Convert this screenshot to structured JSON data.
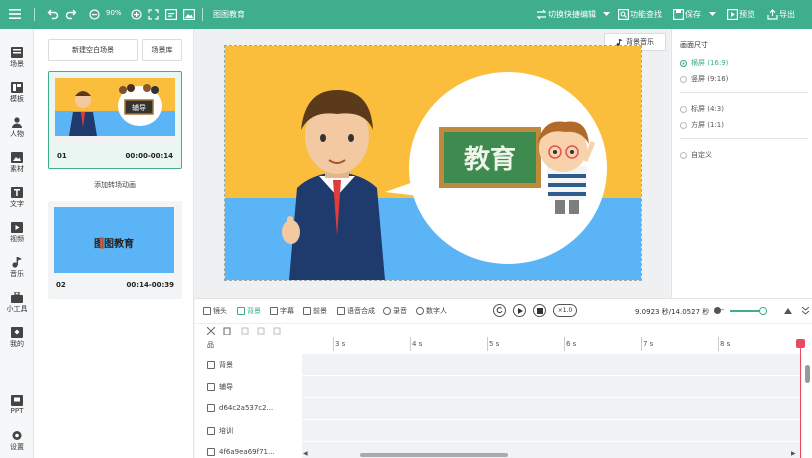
{
  "toolbar": {
    "zoom": "90%",
    "title": "图图教育",
    "quick_edit": "切换快捷编辑",
    "feature_search": "功能查找",
    "save": "保存",
    "preview": "预览",
    "export": "导出"
  },
  "rail": [
    {
      "label": "场景",
      "icon": "scene-icon"
    },
    {
      "label": "模板",
      "icon": "template-icon"
    },
    {
      "label": "人物",
      "icon": "person-icon"
    },
    {
      "label": "素材",
      "icon": "material-icon"
    },
    {
      "label": "文字",
      "icon": "text-icon"
    },
    {
      "label": "视频",
      "icon": "video-icon"
    },
    {
      "label": "音乐",
      "icon": "music-icon"
    },
    {
      "label": "小工具",
      "icon": "tools-icon"
    },
    {
      "label": "我的",
      "icon": "mine-icon"
    },
    {
      "label": "PPT",
      "icon": "ppt-icon"
    },
    {
      "label": "设置",
      "icon": "settings-icon"
    }
  ],
  "scenes": {
    "new_blank": "新建空白场景",
    "library": "场景库",
    "add_transition": "添加转场动画",
    "items": [
      {
        "num": "01",
        "time": "00:00-00:14",
        "caption": "辅导"
      },
      {
        "num": "02",
        "time": "00:14-00:39",
        "caption": "图图教育"
      }
    ]
  },
  "stage": {
    "bg_music": "背景音乐",
    "board_text": "教育"
  },
  "ratio": {
    "title": "画面尺寸",
    "options": [
      {
        "label": "横屏 (16:9)",
        "selected": true
      },
      {
        "label": "竖屏 (9:16)",
        "selected": false
      },
      {
        "label": "标屏 (4:3)",
        "selected": false
      },
      {
        "label": "方屏 (1:1)",
        "selected": false
      },
      {
        "label": "自定义",
        "selected": false
      }
    ]
  },
  "timeline": {
    "tools": [
      "镜头",
      "背景",
      "字幕",
      "前景",
      "语音合成",
      "录音",
      "数字人"
    ],
    "speed": "×1.0",
    "time_readout": "9.0923 秒/14.0527 秒",
    "ticks": [
      "3 s",
      "4 s",
      "5 s",
      "6 s",
      "7 s",
      "8 s"
    ],
    "rows_header": "品",
    "rows": [
      "背景",
      "辅导",
      "d64c2a537c2...",
      "培训",
      "4f6a9ea69f71..."
    ]
  },
  "colors": {
    "brand": "#3fae8d",
    "scene_yellow": "#fbbd3c",
    "scene_blue": "#5ab4f6",
    "playhead": "#e84a5f"
  }
}
